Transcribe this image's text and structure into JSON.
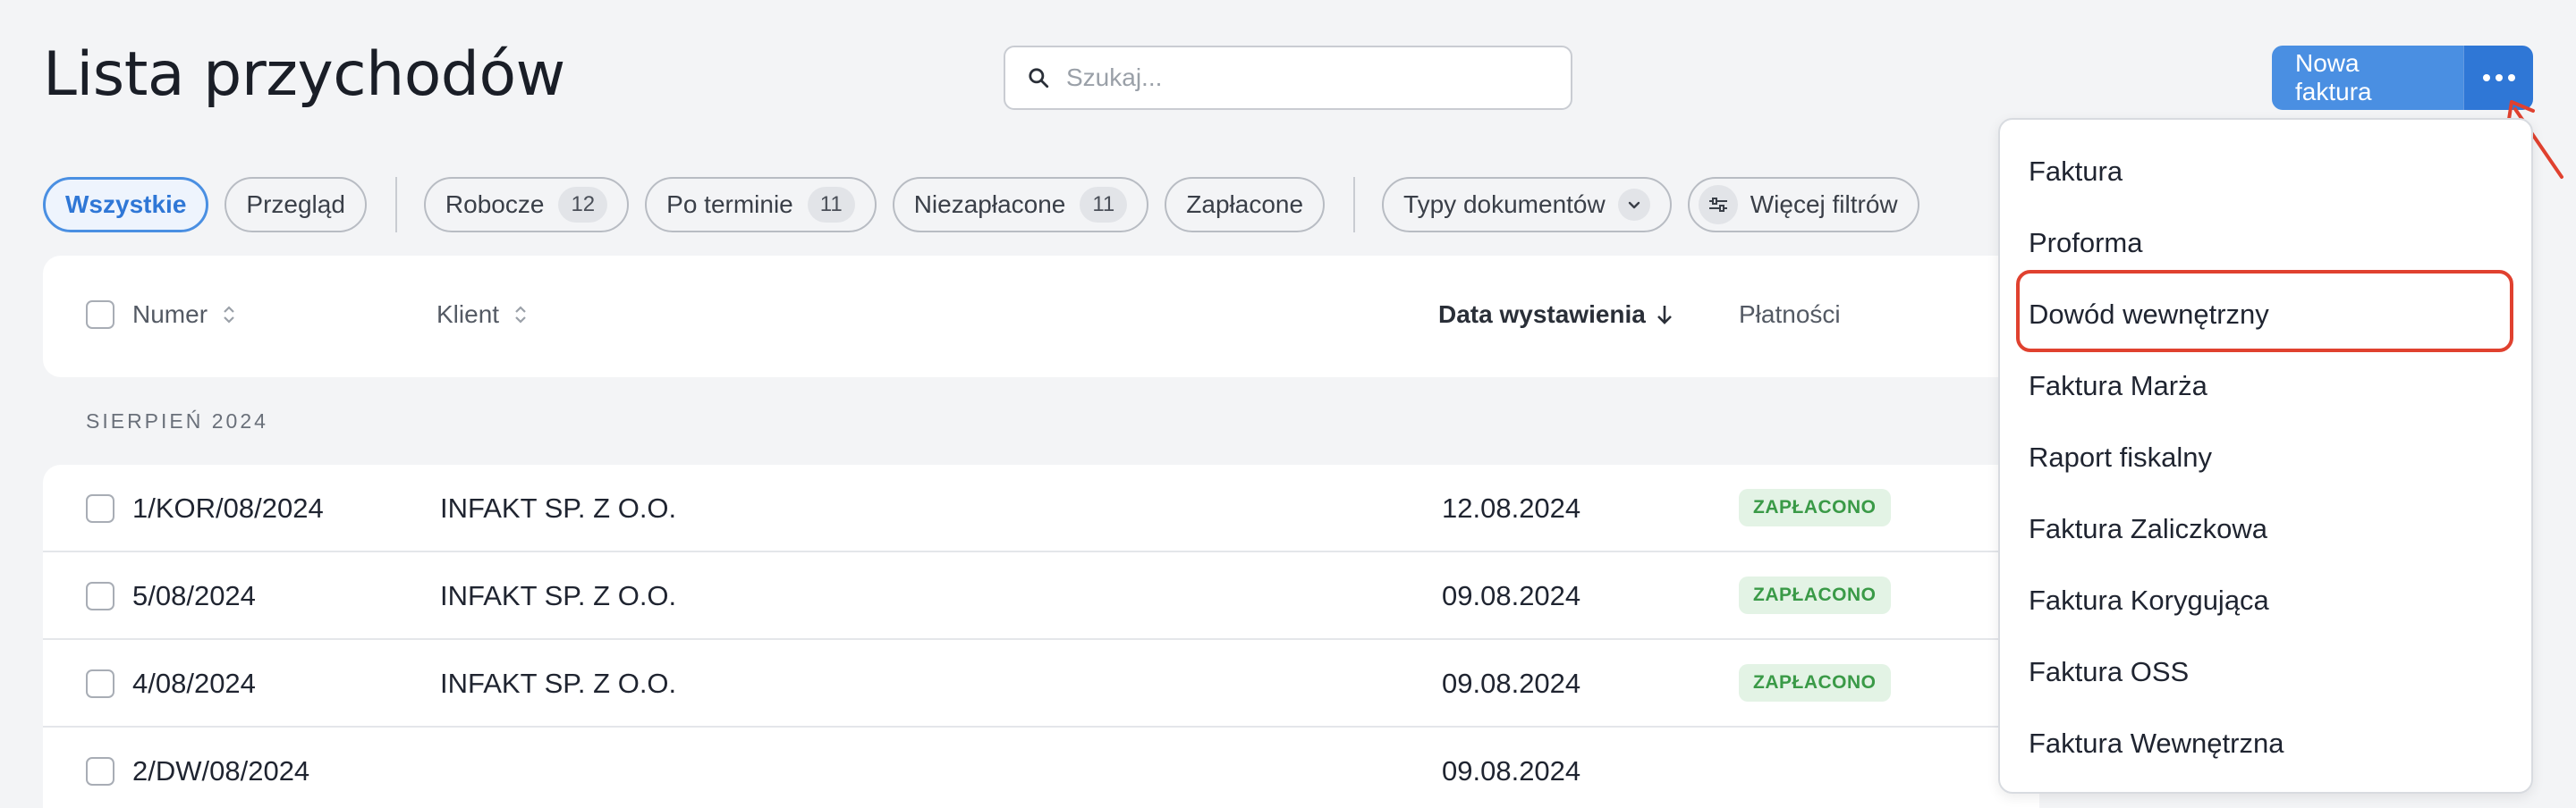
{
  "page_title": "Lista przychodów",
  "search": {
    "placeholder": "Szukaj..."
  },
  "header": {
    "new_invoice_label": "Nowa faktura"
  },
  "filters": {
    "all": "Wszystkie",
    "overview": "Przegląd",
    "drafts": {
      "label": "Robocze",
      "count": "12"
    },
    "overdue": {
      "label": "Po terminie",
      "count": "11"
    },
    "unpaid": {
      "label": "Niezapłacone",
      "count": "11"
    },
    "paid": "Zapłacone",
    "document_types": "Typy dokumentów",
    "more_filters": "Więcej filtrów"
  },
  "table": {
    "columns": {
      "number": "Numer",
      "client": "Klient",
      "issue_date": "Data wystawienia",
      "payments": "Płatności"
    },
    "section": "SIERPIEŃ 2024",
    "rows": [
      {
        "number": "1/KOR/08/2024",
        "client": "INFAKT SP. Z O.O.",
        "date": "12.08.2024",
        "status": "ZAPŁACONO"
      },
      {
        "number": "5/08/2024",
        "client": "INFAKT SP. Z O.O.",
        "date": "09.08.2024",
        "status": "ZAPŁACONO"
      },
      {
        "number": "4/08/2024",
        "client": "INFAKT SP. Z O.O.",
        "date": "09.08.2024",
        "status": "ZAPŁACONO"
      },
      {
        "number": "2/DW/08/2024",
        "client": "",
        "date": "09.08.2024",
        "status": ""
      }
    ]
  },
  "menu": {
    "items": [
      "Faktura",
      "Proforma",
      "Dowód wewnętrzny",
      "Faktura Marża",
      "Raport fiskalny",
      "Faktura Zaliczkowa",
      "Faktura Korygująca",
      "Faktura OSS",
      "Faktura Wewnętrzna"
    ]
  },
  "colors": {
    "accent": "#4a8fe2",
    "accent_dark": "#2f77d6",
    "highlight": "#e0412f",
    "paid_bg": "#e3f3e5",
    "paid_text": "#3a9a47"
  }
}
